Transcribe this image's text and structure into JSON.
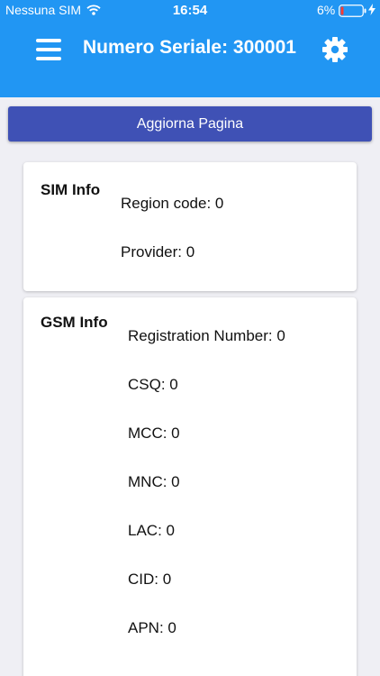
{
  "status_bar": {
    "carrier": "Nessuna SIM",
    "time": "16:54",
    "battery": "6%"
  },
  "header": {
    "title": "Numero Seriale: 300001"
  },
  "refresh_button": "Aggiorna Pagina",
  "sim_info": {
    "title": "SIM Info",
    "rows": [
      "Region code: 0",
      "Provider: 0"
    ]
  },
  "gsm_info": {
    "title": "GSM Info",
    "rows": [
      "Registration Number: 0",
      "CSQ: 0",
      "MCC: 0",
      "MNC: 0",
      "LAC: 0",
      "CID: 0",
      "APN: 0"
    ]
  },
  "colors": {
    "header": "#2196f3",
    "button": "#3f51b5",
    "background": "#efeff4",
    "battery_low": "#ff3b30"
  },
  "icons": {
    "menu": "hamburger-icon",
    "settings": "gear-icon",
    "wifi": "wifi-icon",
    "battery": "battery-icon",
    "charging": "bolt-icon"
  }
}
